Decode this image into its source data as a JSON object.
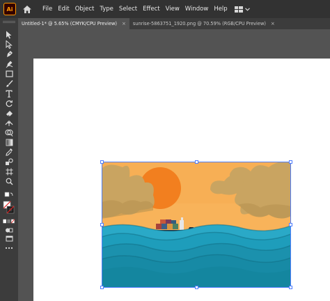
{
  "app": {
    "logo_text": "Ai",
    "accent_color": "#ff9a00"
  },
  "menu": {
    "items": [
      "File",
      "Edit",
      "Object",
      "Type",
      "Select",
      "Effect",
      "View",
      "Window",
      "Help"
    ]
  },
  "tabs": [
    {
      "label": "Untitled-1* @ 5.65% (CMYK/CPU Preview)",
      "close": "×",
      "active": true
    },
    {
      "label": "sunrise-5863751_1920.png @ 70.59% (RGB/CPU Preview)",
      "close": "×",
      "active": false
    }
  ],
  "toolbar": {
    "tools": [
      "selection-tool-icon",
      "direct-selection-tool-icon",
      "pen-tool-icon",
      "curvature-tool-icon",
      "rectangle-tool-icon",
      "paintbrush-tool-icon",
      "type-tool-icon",
      "rotate-tool-icon",
      "eraser-tool-icon",
      "width-tool-icon",
      "shape-builder-tool-icon",
      "gradient-tool-icon",
      "eyedropper-tool-icon",
      "blend-tool-icon",
      "artboard-tool-icon",
      "zoom-tool-icon"
    ]
  },
  "colors": {
    "sky": "#f8b35a",
    "sun": "#f27f1f",
    "cloud": "#c9a461",
    "wave_light": "#2aa9c7",
    "wave_dark": "#14869f",
    "selection": "#4f7dff"
  }
}
